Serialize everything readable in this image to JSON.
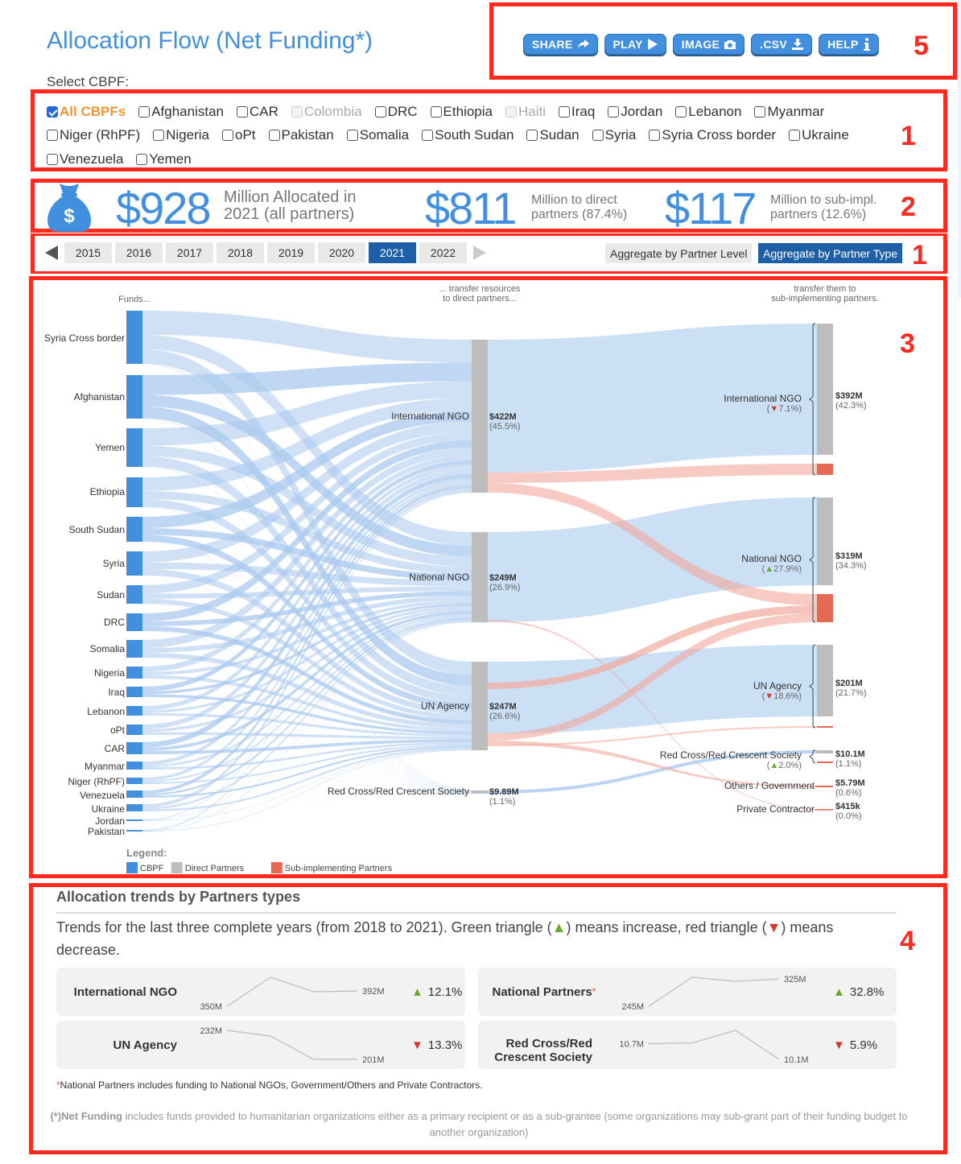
{
  "header": {
    "title": "Allocation Flow (Net Funding*)",
    "select_label": "Select CBPF:"
  },
  "toolbar": {
    "buttons": [
      {
        "label": "SHARE",
        "icon": "share-icon"
      },
      {
        "label": "PLAY",
        "icon": "play-icon"
      },
      {
        "label": "IMAGE",
        "icon": "camera-icon"
      },
      {
        "label": ".CSV",
        "icon": "download-icon"
      },
      {
        "label": "HELP",
        "icon": "info-icon"
      }
    ]
  },
  "annotations": {
    "box1": "1",
    "box2": "2",
    "box1b": "1",
    "box3": "3",
    "box4": "4",
    "box5": "5"
  },
  "cbpf_filter": {
    "rows": [
      [
        {
          "label": "All CBPFs",
          "state": "checked"
        },
        {
          "label": "Afghanistan",
          "state": "unchecked"
        },
        {
          "label": "CAR",
          "state": "unchecked"
        },
        {
          "label": "Colombia",
          "state": "disabled"
        },
        {
          "label": "DRC",
          "state": "unchecked"
        },
        {
          "label": "Ethiopia",
          "state": "unchecked"
        },
        {
          "label": "Haiti",
          "state": "disabled"
        },
        {
          "label": "Iraq",
          "state": "unchecked"
        },
        {
          "label": "Jordan",
          "state": "unchecked"
        },
        {
          "label": "Lebanon",
          "state": "unchecked"
        },
        {
          "label": "Myanmar",
          "state": "unchecked"
        }
      ],
      [
        {
          "label": "Niger (RhPF)",
          "state": "unchecked"
        },
        {
          "label": "Nigeria",
          "state": "unchecked"
        },
        {
          "label": "oPt",
          "state": "unchecked"
        },
        {
          "label": "Pakistan",
          "state": "unchecked"
        },
        {
          "label": "Somalia",
          "state": "unchecked"
        },
        {
          "label": "South Sudan",
          "state": "unchecked"
        },
        {
          "label": "Sudan",
          "state": "unchecked"
        },
        {
          "label": "Syria",
          "state": "unchecked"
        },
        {
          "label": "Syria Cross border",
          "state": "unchecked"
        },
        {
          "label": "Ukraine",
          "state": "unchecked"
        }
      ],
      [
        {
          "label": "Venezuela",
          "state": "unchecked"
        },
        {
          "label": "Yemen",
          "state": "unchecked"
        }
      ]
    ]
  },
  "summary": {
    "total": {
      "value": "$928",
      "text_line1": "Million Allocated in",
      "text_line2": "2021 (all partners)"
    },
    "direct": {
      "value": "$811",
      "text_line1": "Million to direct",
      "text_line2": "partners (87.4%)"
    },
    "sub": {
      "value": "$117",
      "text_line1": "Million to sub-impl.",
      "text_line2": "partners (12.6%)"
    }
  },
  "years": {
    "items": [
      "2015",
      "2016",
      "2017",
      "2018",
      "2019",
      "2020",
      "2021",
      "2022"
    ],
    "selected": "2021"
  },
  "aggregate": {
    "by_level": "Aggregate by Partner Level",
    "by_type": "Aggregate by Partner Type",
    "selected": "by_type"
  },
  "colors": {
    "cbpf": "#418fde",
    "direct": "#bdbdbd",
    "sub": "#e56a54",
    "link_blue": "#a9c9ee",
    "link_red": "#f2a99c",
    "up": "#6aaa2a",
    "down": "#d23b2b"
  },
  "chart_data": {
    "type": "sankey",
    "column_headers": {
      "funds": "Funds...",
      "direct": "... transfer resources\nto direct partners...",
      "sub": "transfer them to\nsub-implementing partners."
    },
    "funds": [
      "Syria Cross border",
      "Afghanistan",
      "Yemen",
      "Ethiopia",
      "South Sudan",
      "Syria",
      "Sudan",
      "DRC",
      "Somalia",
      "Nigeria",
      "Iraq",
      "Lebanon",
      "oPt",
      "CAR",
      "Myanmar",
      "Niger (RhPF)",
      "Venezuela",
      "Ukraine",
      "Jordan",
      "Pakistan"
    ],
    "direct_partners": [
      {
        "name": "International NGO",
        "value": "$422M",
        "pct": "(45.5%)",
        "amount_m": 422
      },
      {
        "name": "National NGO",
        "value": "$249M",
        "pct": "(26.9%)",
        "amount_m": 249
      },
      {
        "name": "UN Agency",
        "value": "$247M",
        "pct": "(26.6%)",
        "amount_m": 247
      },
      {
        "name": "Red Cross/Red Crescent Society",
        "value": "$9.89M",
        "pct": "(1.1%)",
        "amount_m": 9.89
      }
    ],
    "net_partners": [
      {
        "name": "International NGO",
        "value": "$392M",
        "pct": "(42.3%)",
        "change": "7.1%",
        "dir": "down",
        "direct_m": 392,
        "sub_m": 13
      },
      {
        "name": "National NGO",
        "value": "$319M",
        "pct": "(34.3%)",
        "change": "27.9%",
        "dir": "up",
        "direct_m": 249,
        "sub_m": 70
      },
      {
        "name": "UN Agency",
        "value": "$201M",
        "pct": "(21.7%)",
        "change": "18.6%",
        "dir": "down",
        "direct_m": 201,
        "sub_m": 0.5
      },
      {
        "name": "Red Cross/Red Crescent Society",
        "value": "$10.1M",
        "pct": "(1.1%)",
        "change": "2.0%",
        "dir": "up",
        "direct_m": 9.89,
        "sub_m": 0.3
      },
      {
        "name": "Others / Government",
        "value": "$5.79M",
        "pct": "(0.6%)",
        "change": null,
        "dir": null,
        "direct_m": 0,
        "sub_m": 5.79
      },
      {
        "name": "Private Contractor",
        "value": "$415k",
        "pct": "(0.0%)",
        "change": null,
        "dir": null,
        "direct_m": 0,
        "sub_m": 0.415
      }
    ],
    "legend": {
      "title": "Legend:",
      "items": [
        {
          "label": "CBPF",
          "color": "#418fde"
        },
        {
          "label": "Direct Partners",
          "color": "#bdbdbd"
        },
        {
          "label": "Sub-implementing Partners",
          "color": "#e56a54"
        }
      ]
    }
  },
  "trends": {
    "title": "Allocation trends by Partners types",
    "desc_before": "Trends for the last three complete years (from 2018 to 2021). Green triangle (",
    "desc_mid": ") means increase, red triangle (",
    "desc_after": ") means decrease.",
    "up_glyph": "▲",
    "down_glyph": "▼",
    "cards": [
      {
        "label": "International NGO",
        "asterisk": "",
        "start": "350M",
        "end": "392M",
        "change": "12.1%",
        "dir": "up",
        "series": [
          350,
          430,
          390,
          392
        ]
      },
      {
        "label": "National Partners",
        "asterisk": "*",
        "start": "245M",
        "end": "325M",
        "change": "32.8%",
        "dir": "up",
        "series": [
          245,
          330,
          318,
          325
        ]
      },
      {
        "label": "UN Agency",
        "asterisk": "",
        "start": "232M",
        "end": "201M",
        "change": "13.3%",
        "dir": "down",
        "series": [
          232,
          226,
          201,
          201
        ]
      },
      {
        "label": "Red Cross/Red Crescent Society",
        "asterisk": "",
        "start": "10.7M",
        "end": "10.1M",
        "change": "5.9%",
        "dir": "down",
        "series": [
          10.7,
          10.72,
          11.2,
          10.1
        ]
      }
    ],
    "note_star": "*",
    "note": "National Partners includes funding to National NGOs, Government/Others and Private Contractors.",
    "footnote_bold": "(*)Net Funding",
    "footnote": " includes funds provided to humanitarian organizations either as a primary recipient or as a sub-grantee (some organizations may sub-grant part of their funding budget to another organization)"
  }
}
